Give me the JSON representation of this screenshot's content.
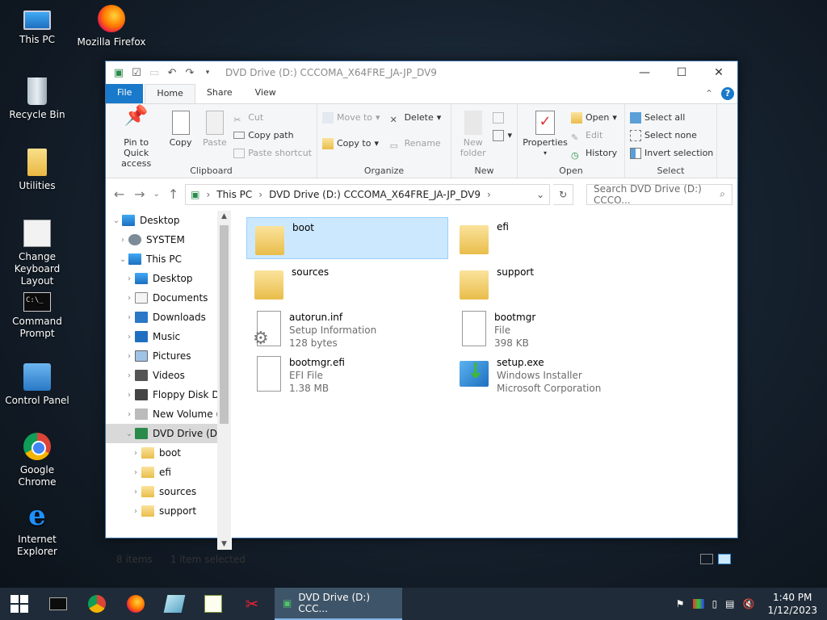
{
  "desktop": {
    "icons": [
      {
        "label": "This PC"
      },
      {
        "label": "Mozilla Firefox"
      },
      {
        "label": "Recycle Bin"
      },
      {
        "label": "Utilities"
      },
      {
        "label": "Change Keyboard Layout"
      },
      {
        "label": "Command Prompt"
      },
      {
        "label": "Control Panel"
      },
      {
        "label": "Google Chrome"
      },
      {
        "label": "Internet Explorer"
      }
    ]
  },
  "window": {
    "title": "DVD Drive (D:) CCCOMA_X64FRE_JA-JP_DV9",
    "controls": {
      "minimize": "—",
      "maximize": "☐",
      "close": "✕"
    }
  },
  "ribbon": {
    "tabs": [
      "File",
      "Home",
      "Share",
      "View"
    ],
    "active_tab": "Home",
    "clipboard": {
      "label": "Clipboard",
      "pin": "Pin to Quick access",
      "copy": "Copy",
      "paste": "Paste",
      "cut": "Cut",
      "copy_path": "Copy path",
      "paste_shortcut": "Paste shortcut"
    },
    "organize": {
      "label": "Organize",
      "move_to": "Move to",
      "copy_to": "Copy to",
      "delete": "Delete",
      "rename": "Rename"
    },
    "new": {
      "label": "New",
      "new_folder": "New folder"
    },
    "open": {
      "label": "Open",
      "properties": "Properties",
      "open": "Open",
      "edit": "Edit",
      "history": "History"
    },
    "select": {
      "label": "Select",
      "select_all": "Select all",
      "select_none": "Select none",
      "invert": "Invert selection"
    }
  },
  "address": {
    "crumbs": [
      "This PC",
      "DVD Drive (D:) CCCOMA_X64FRE_JA-JP_DV9"
    ],
    "search_placeholder": "Search DVD Drive (D:) CCCO..."
  },
  "nav": {
    "items": [
      {
        "label": "Desktop",
        "level": 0,
        "expander": "⌄",
        "selected": false
      },
      {
        "label": "SYSTEM",
        "level": 1,
        "expander": "›",
        "selected": false
      },
      {
        "label": "This PC",
        "level": 1,
        "expander": "⌄",
        "selected": false
      },
      {
        "label": "Desktop",
        "level": 2,
        "expander": "›",
        "selected": false
      },
      {
        "label": "Documents",
        "level": 2,
        "expander": "›",
        "selected": false
      },
      {
        "label": "Downloads",
        "level": 2,
        "expander": "›",
        "selected": false
      },
      {
        "label": "Music",
        "level": 2,
        "expander": "›",
        "selected": false
      },
      {
        "label": "Pictures",
        "level": 2,
        "expander": "›",
        "selected": false
      },
      {
        "label": "Videos",
        "level": 2,
        "expander": "›",
        "selected": false
      },
      {
        "label": "Floppy Disk Dri",
        "level": 2,
        "expander": "›",
        "selected": false
      },
      {
        "label": "New Volume (C",
        "level": 2,
        "expander": "›",
        "selected": false
      },
      {
        "label": "DVD Drive (D:)",
        "level": 2,
        "expander": "⌄",
        "selected": true
      },
      {
        "label": "boot",
        "level": 3,
        "expander": "›",
        "selected": false
      },
      {
        "label": "efi",
        "level": 3,
        "expander": "›",
        "selected": false
      },
      {
        "label": "sources",
        "level": 3,
        "expander": "›",
        "selected": false
      },
      {
        "label": "support",
        "level": 3,
        "expander": "›",
        "selected": false
      }
    ]
  },
  "files": [
    {
      "name": "boot",
      "type": "folder",
      "line2": "",
      "line3": "",
      "selected": true
    },
    {
      "name": "efi",
      "type": "folder",
      "line2": "",
      "line3": "",
      "selected": false
    },
    {
      "name": "sources",
      "type": "folder",
      "line2": "",
      "line3": "",
      "selected": false
    },
    {
      "name": "support",
      "type": "folder",
      "line2": "",
      "line3": "",
      "selected": false
    },
    {
      "name": "autorun.inf",
      "type": "setup-info",
      "line2": "Setup Information",
      "line3": "128 bytes",
      "selected": false
    },
    {
      "name": "bootmgr",
      "type": "file",
      "line2": "File",
      "line3": "398 KB",
      "selected": false
    },
    {
      "name": "bootmgr.efi",
      "type": "file",
      "line2": "EFI File",
      "line3": "1.38 MB",
      "selected": false
    },
    {
      "name": "setup.exe",
      "type": "installer",
      "line2": "Windows Installer",
      "line3": "Microsoft Corporation",
      "selected": false
    }
  ],
  "status": {
    "count": "8 items",
    "selection": "1 item selected"
  },
  "taskbar": {
    "active_window": "DVD Drive (D:) CCC...",
    "time": "1:40 PM",
    "date": "1/12/2023"
  }
}
